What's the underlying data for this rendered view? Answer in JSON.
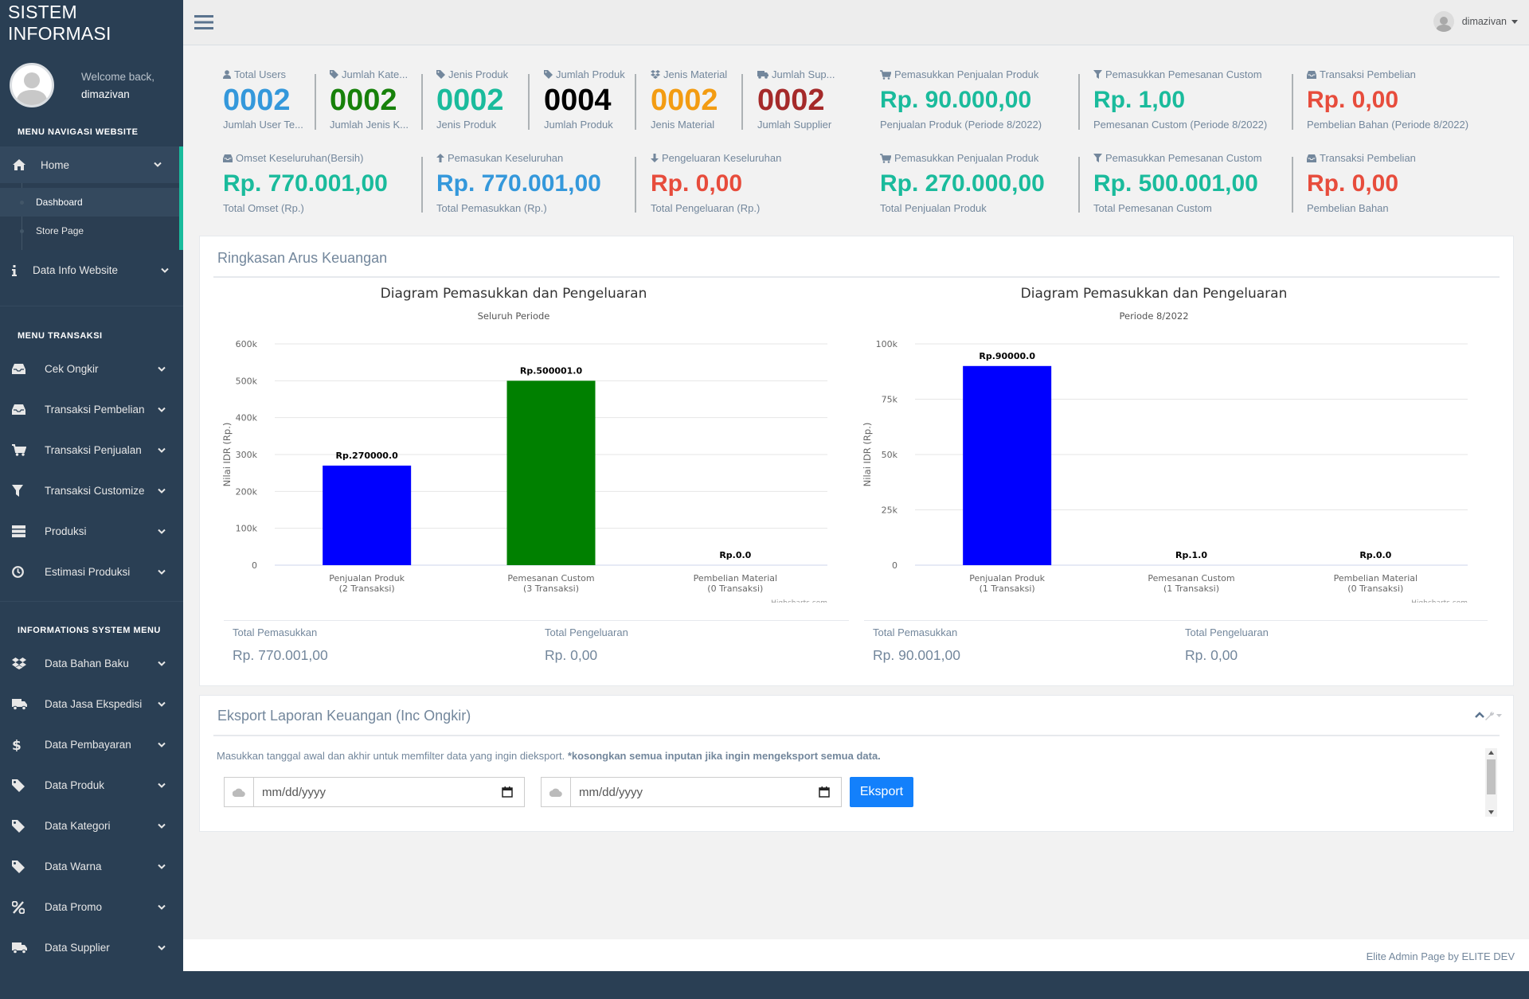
{
  "brand": "SISTEM INFORMASI",
  "profile": {
    "welcome": "Welcome back,",
    "name": "dimazivan"
  },
  "topbar": {
    "user": "dimazivan"
  },
  "sidebar": {
    "menu1": "MENU NAVIGASI WEBSITE",
    "home": "Home",
    "home_sub": [
      "Dashboard",
      "Store Page"
    ],
    "data_info": "Data Info Website",
    "menu2": "MENU TRANSAKSI",
    "trans": [
      "Cek Ongkir",
      "Transaksi Pembelian",
      "Transaksi Penjualan",
      "Transaksi Customize",
      "Produksi",
      "Estimasi Produksi"
    ],
    "menu3": "INFORMATIONS SYSTEM MENU",
    "info": [
      "Data Bahan Baku",
      "Data Jasa Ekspedisi",
      "Data Pembayaran",
      "Data Produk",
      "Data Kategori",
      "Data Warna",
      "Data Promo",
      "Data Supplier"
    ]
  },
  "stats_row1": [
    {
      "title": "Total Users",
      "value": "0002",
      "sub": "Jumlah User Te...",
      "color": "#3498db",
      "icon": "user-icon"
    },
    {
      "title": "Jumlah Kate...",
      "value": "0002",
      "sub": "Jumlah Jenis K...",
      "color": "#17810a",
      "icon": "tag-icon"
    },
    {
      "title": "Jenis Produk",
      "value": "0002",
      "sub": "Jenis Produk",
      "color": "#1abb9c",
      "icon": "tag-icon"
    },
    {
      "title": "Jumlah Produk",
      "value": "0004",
      "sub": "Jumlah Produk",
      "color": "#000000",
      "icon": "tag-icon"
    },
    {
      "title": "Jenis Material",
      "value": "0002",
      "sub": "Jenis Material",
      "color": "#f39c12",
      "icon": "dropbox-icon"
    },
    {
      "title": "Jumlah Sup...",
      "value": "0002",
      "sub": "Jumlah Supplier",
      "color": "#a52a2a",
      "icon": "truck-icon"
    }
  ],
  "stats_row1_right": [
    {
      "title": "Pemasukkan Penjualan Produk",
      "value": "Rp. 90.000,00",
      "sub": "Penjualan Produk (Periode 8/2022)",
      "color": "#1abb9c",
      "icon": "cart-icon"
    },
    {
      "title": "Pemasukkan Pemesanan Custom",
      "value": "Rp. 1,00",
      "sub": "Pemesanan Custom (Periode 8/2022)",
      "color": "#1abb9c",
      "icon": "filter-icon"
    },
    {
      "title": "Transaksi Pembelian",
      "value": "Rp. 0,00",
      "sub": "Pembelian Bahan (Periode 8/2022)",
      "color": "#e74c3c",
      "icon": "inbox-icon"
    }
  ],
  "stats_row2": [
    {
      "title": "Omset Keseluruhan(Bersih)",
      "value": "Rp. 770.001,00",
      "sub": "Total Omset (Rp.)",
      "color": "#1abb9c",
      "icon": "inbox-icon"
    },
    {
      "title": "Pemasukan Keseluruhan",
      "value": "Rp. 770.001,00",
      "sub": "Total Pemasukkan (Rp.)",
      "color": "#3498db",
      "icon": "arrow-up-icon"
    },
    {
      "title": "Pengeluaran Keseluruhan",
      "value": "Rp. 0,00",
      "sub": "Total Pengeluaran (Rp.)",
      "color": "#e74c3c",
      "icon": "arrow-down-icon"
    }
  ],
  "stats_row2_right": [
    {
      "title": "Pemasukkan Penjualan Produk",
      "value": "Rp. 270.000,00",
      "sub": "Total Penjualan Produk",
      "color": "#1abb9c",
      "icon": "cart-icon"
    },
    {
      "title": "Pemasukkan Pemesanan Custom",
      "value": "Rp. 500.001,00",
      "sub": "Total Pemesanan Custom",
      "color": "#1abb9c",
      "icon": "filter-icon"
    },
    {
      "title": "Transaksi Pembelian",
      "value": "Rp. 0,00",
      "sub": "Pembelian Bahan",
      "color": "#e74c3c",
      "icon": "inbox-icon"
    }
  ],
  "summary": {
    "title": "Ringkasan Arus Keuangan",
    "left": {
      "in_label": "Total Pemasukkan",
      "in_value": "Rp. 770.001,00",
      "out_label": "Total Pengeluaran",
      "out_value": "Rp. 0,00"
    },
    "right": {
      "in_label": "Total Pemasukkan",
      "in_value": "Rp. 90.001,00",
      "out_label": "Total Pengeluaran",
      "out_value": "Rp. 0,00"
    }
  },
  "chart_data": [
    {
      "type": "bar",
      "title": "Diagram Pemasukkan dan Pengeluaran",
      "subtitle": "Seluruh Periode",
      "ylabel": "Nilai IDR (Rp.)",
      "ylim": [
        0,
        600000
      ],
      "yticks": [
        "0",
        "100k",
        "200k",
        "300k",
        "400k",
        "500k",
        "600k"
      ],
      "ytick_values": [
        0,
        100000,
        200000,
        300000,
        400000,
        500000,
        600000
      ],
      "categories": [
        "Penjualan Produk|(2 Transaksi)",
        "Pemesanan Custom|(3 Transaksi)",
        "Pembelian Material|(0 Transaksi)"
      ],
      "values": [
        270000,
        500001,
        0
      ],
      "labels": [
        "Rp.270000.0",
        "Rp.500001.0",
        "Rp.0.0"
      ],
      "colors": [
        "#0000ff",
        "#008000",
        "#ff0000"
      ],
      "credit": "Highcharts.com"
    },
    {
      "type": "bar",
      "title": "Diagram Pemasukkan dan Pengeluaran",
      "subtitle": "Periode 8/2022",
      "ylabel": "Nilai IDR (Rp.)",
      "ylim": [
        0,
        100000
      ],
      "yticks": [
        "0",
        "25k",
        "50k",
        "75k",
        "100k"
      ],
      "ytick_values": [
        0,
        25000,
        50000,
        75000,
        100000
      ],
      "categories": [
        "Penjualan Produk|(1 Transaksi)",
        "Pemesanan Custom|(1 Transaksi)",
        "Pembelian Material|(0 Transaksi)"
      ],
      "values": [
        90000,
        1,
        0
      ],
      "labels": [
        "Rp.90000.0",
        "Rp.1.0",
        "Rp.0.0"
      ],
      "colors": [
        "#0000ff",
        "#008000",
        "#ff0000"
      ],
      "credit": "Highcharts.com"
    }
  ],
  "export": {
    "title": "Eksport Laporan Keuangan (Inc Ongkir)",
    "desc": "Masukkan tanggal awal dan akhir untuk memfilter data yang ingin dieksport. ",
    "desc_bold": "*kosongkan semua inputan jika ingin mengeksport semua data.",
    "date_placeholder": "mm/dd/yyyy",
    "button": "Eksport"
  },
  "footer": "Elite Admin Page by  ELITE DEV"
}
